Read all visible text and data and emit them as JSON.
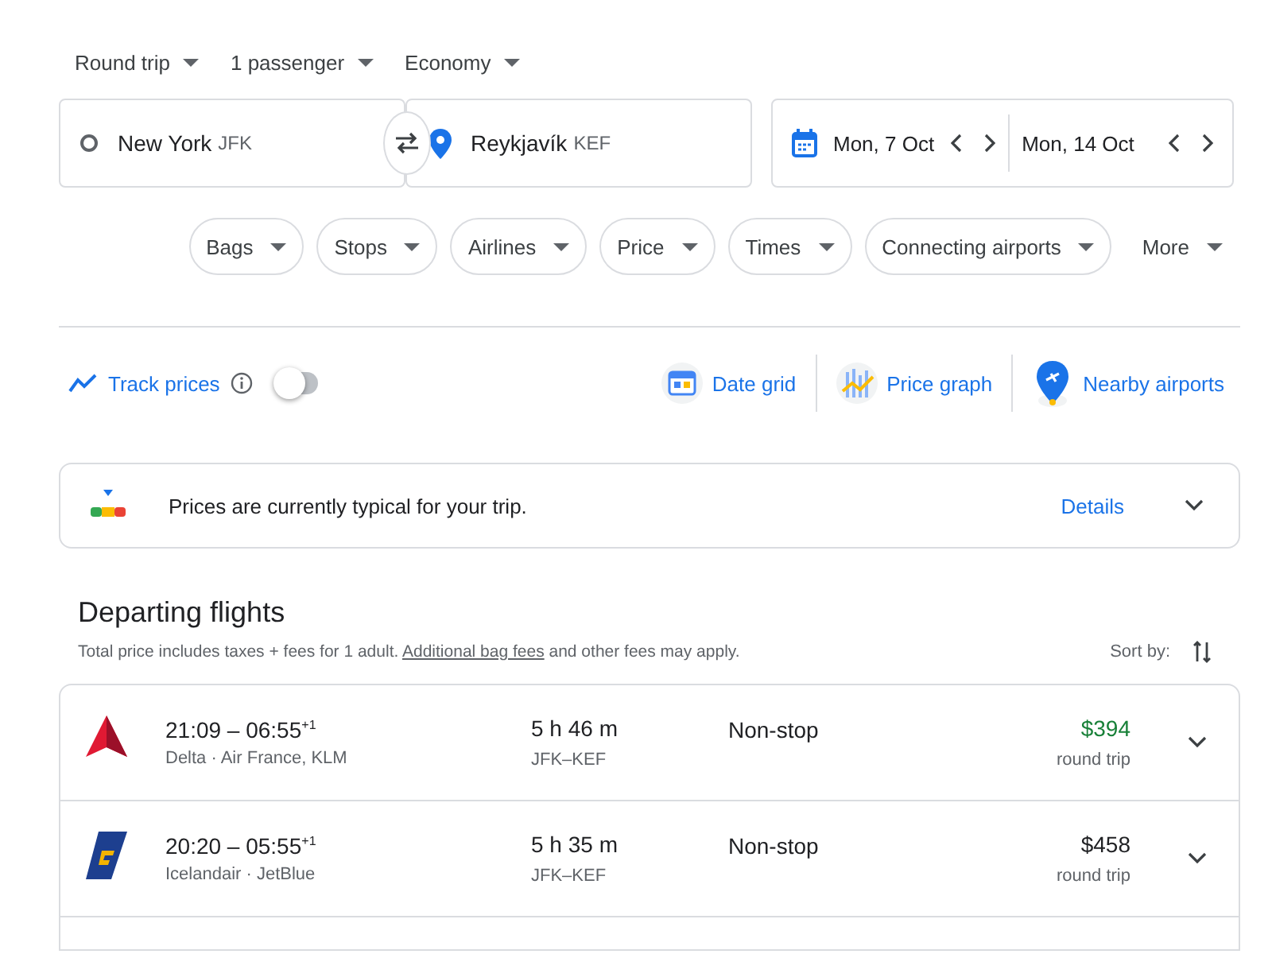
{
  "trip_options": [
    {
      "label": "Round trip"
    },
    {
      "label": "1 passenger"
    },
    {
      "label": "Economy"
    }
  ],
  "search": {
    "origin": {
      "city": "New York",
      "code": "JFK"
    },
    "destination": {
      "city": "Reykjavík",
      "code": "KEF"
    },
    "departure_date": "Mon, 7 Oct",
    "return_date": "Mon, 14 Oct"
  },
  "filters": [
    {
      "label": "Bags",
      "kind": "chip"
    },
    {
      "label": "Stops",
      "kind": "chip"
    },
    {
      "label": "Airlines",
      "kind": "chip"
    },
    {
      "label": "Price",
      "kind": "chip"
    },
    {
      "label": "Times",
      "kind": "chip"
    },
    {
      "label": "Connecting airports",
      "kind": "chip"
    },
    {
      "label": "More",
      "kind": "plain"
    }
  ],
  "track_prices": {
    "label": "Track prices",
    "on": false
  },
  "tools": [
    {
      "label": "Date grid",
      "kind": "calendar"
    },
    {
      "label": "Price graph",
      "kind": "graph"
    },
    {
      "label": "Nearby airports",
      "kind": "pin"
    }
  ],
  "price_insight": {
    "text": "Prices are currently typical for your trip.",
    "link": "Details"
  },
  "departing": {
    "title": "Departing flights",
    "note": "Total price includes taxes + fees for 1 adult.",
    "note_link": "Additional bag fees",
    "note_tail": "and other fees may apply.",
    "sort_label": "Sort by:"
  },
  "flights": [
    {
      "kind": "triangle",
      "times": "21:09 – 06:55$^{+1}$",
      "carriers": "Delta · Air France, KLM",
      "duration": "5 h 46 m",
      "route": "JFK–KEF",
      "stops": "Non-stop",
      "price": "$394",
      "price_note": "round trip",
      "cheapest": true
    },
    {
      "kind": "tail",
      "times": "20:20 – 05:55$^{+1}$",
      "carriers": "Icelandair · JetBlue",
      "duration": "5 h 35 m",
      "route": "JFK–KEF",
      "stops": "Non-stop",
      "price": "$458",
      "price_note": "round trip",
      "cheapest": false
    }
  ]
}
